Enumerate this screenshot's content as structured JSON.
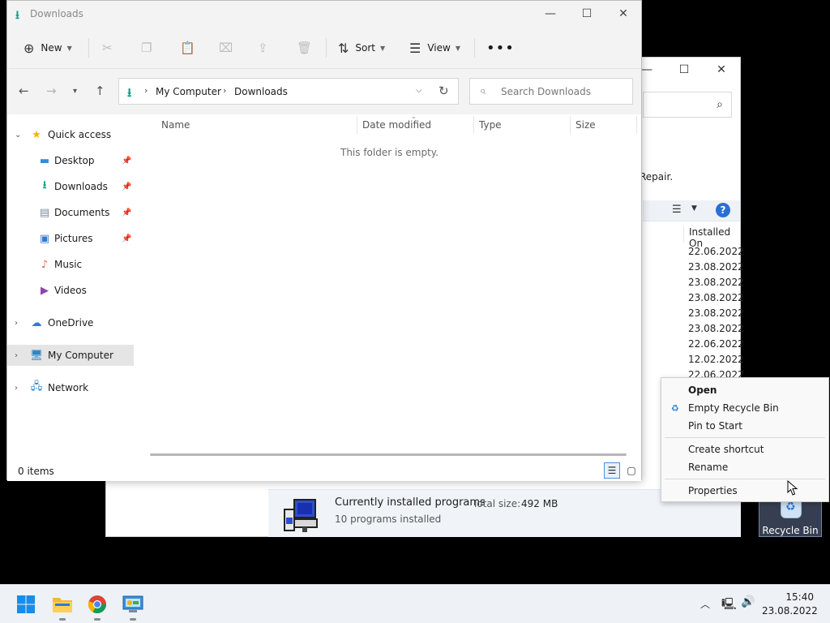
{
  "background_window": {
    "repair_text": "Repair.",
    "column_installed_on": "Installed On",
    "installed_dates": [
      "22.06.2022",
      "23.08.2022",
      "23.08.2022",
      "23.08.2022",
      "23.08.2022",
      "23.08.2022",
      "22.06.2022",
      "12.02.2022",
      "22.06.2022"
    ],
    "status_title": "Currently installed programs",
    "total_size_label": "Total size:",
    "total_size_value": "492 MB",
    "programs_count": "10 programs installed"
  },
  "desktop": {
    "recycle_bin_label": "Recycle Bin"
  },
  "explorer": {
    "title": "Downloads",
    "commands": {
      "new": "New",
      "sort": "Sort",
      "view": "View"
    },
    "breadcrumb": [
      "My Computer",
      "Downloads"
    ],
    "search_placeholder": "Search Downloads",
    "sidebar": {
      "quick_access": "Quick access",
      "items": [
        {
          "label": "Desktop",
          "pinned": true
        },
        {
          "label": "Downloads",
          "pinned": true
        },
        {
          "label": "Documents",
          "pinned": true
        },
        {
          "label": "Pictures",
          "pinned": true
        },
        {
          "label": "Music",
          "pinned": false
        },
        {
          "label": "Videos",
          "pinned": false
        }
      ],
      "onedrive": "OneDrive",
      "my_computer": "My Computer",
      "network": "Network"
    },
    "columns": {
      "name": "Name",
      "date_modified": "Date modified",
      "type": "Type",
      "size": "Size"
    },
    "empty_message": "This folder is empty.",
    "status_items": "0 items"
  },
  "context_menu": {
    "items": [
      "Open",
      "Empty Recycle Bin",
      "Pin to Start",
      "Create shortcut",
      "Rename",
      "Properties"
    ]
  },
  "taskbar": {
    "time": "15:40",
    "date": "23.08.2022"
  },
  "colors": {
    "accent_green": "#16a085",
    "accent_blue": "#2e7bd6",
    "selection": "#e5e5e5"
  }
}
